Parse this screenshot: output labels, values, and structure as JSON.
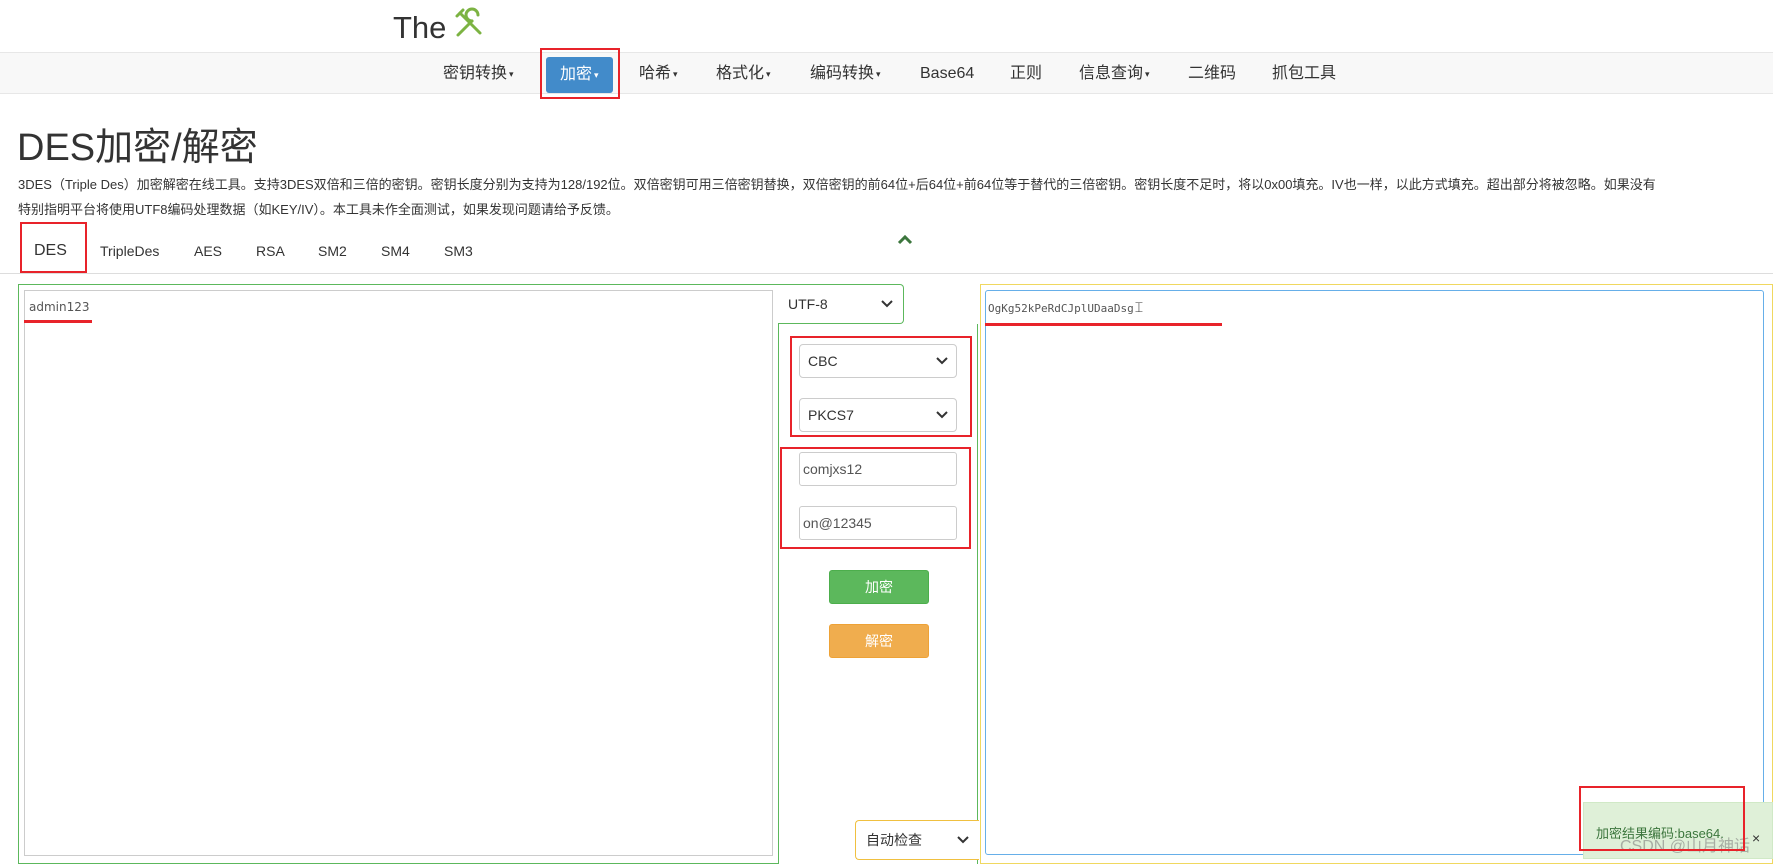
{
  "brand": {
    "text": "The",
    "icon": "tools-icon"
  },
  "nav": {
    "items": [
      {
        "label": "密钥转换",
        "dropdown": true
      },
      {
        "label": "加密",
        "dropdown": true,
        "active": true
      },
      {
        "label": "哈希",
        "dropdown": true
      },
      {
        "label": "格式化",
        "dropdown": true
      },
      {
        "label": "编码转换",
        "dropdown": true
      },
      {
        "label": "Base64",
        "dropdown": false
      },
      {
        "label": "正则",
        "dropdown": false
      },
      {
        "label": "信息查询",
        "dropdown": true
      },
      {
        "label": "二维码",
        "dropdown": false
      },
      {
        "label": "抓包工具",
        "dropdown": false
      }
    ],
    "caret": "▾"
  },
  "page": {
    "title": "DES加密/解密",
    "desc_line1": "3DES（Triple Des）加密解密在线工具。支持3DES双倍和三倍的密钥。密钥长度分别为支持为128/192位。双倍密钥可用三倍密钥替换，双倍密钥的前64位+后64位+前64位等于替代的三倍密钥。密钥长度不足时，将以0x00填充。IV也一样，以此方式填充。超出部分将被忽略。如果没有",
    "desc_line2": "特别指明平台将使用UTF8编码处理数据（如KEY/IV）。本工具未作全面测试，如果发现问题请给予反馈。"
  },
  "tabs": [
    "DES",
    "TripleDes",
    "AES",
    "RSA",
    "SM2",
    "SM4",
    "SM3"
  ],
  "collapse_glyph": "⌃",
  "input": {
    "text": "admin123"
  },
  "options": {
    "encoding": "UTF-8",
    "mode": "CBC",
    "padding": "PKCS7",
    "key": "comjxs12",
    "iv": "on@12345",
    "encrypt_label": "加密",
    "decrypt_label": "解密",
    "output_encoding": "自动检查",
    "chevron": "⌄"
  },
  "output": {
    "text": "OgKg52kPeRdCJplUDaaDsg",
    "cursor": "⌶"
  },
  "toast": {
    "text": "加密结果编码:base64.",
    "close": "×"
  },
  "watermark": "CSDN @山月神话",
  "colors": {
    "accent": "#428bca",
    "success": "#5cb85c",
    "warning": "#f0ad4e",
    "annotation": "#e8232a"
  }
}
